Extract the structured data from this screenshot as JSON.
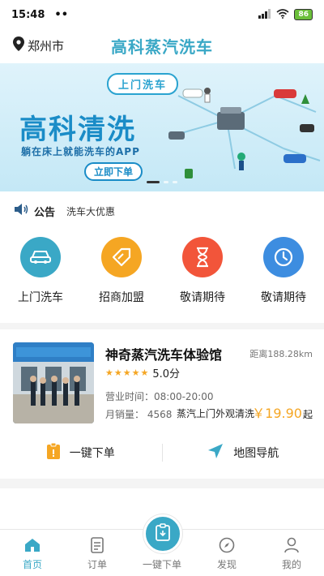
{
  "status_bar": {
    "time": "15:48",
    "dots": "••",
    "battery": "86"
  },
  "header": {
    "location": "郑州市",
    "title": "高科蒸汽洗车"
  },
  "banner": {
    "tag": "上门洗车",
    "heading": "高科清洗",
    "subtitle": "躺在床上就能洗车的APP",
    "button": "立即下单"
  },
  "notice": {
    "title": "公告",
    "text": "洗车大优惠"
  },
  "services": [
    {
      "label": "上门洗车",
      "color": "#3aa8c6",
      "icon": "car-icon"
    },
    {
      "label": "招商加盟",
      "color": "#f5a623",
      "icon": "tag-icon"
    },
    {
      "label": "敬请期待",
      "color": "#f2553a",
      "icon": "hourglass-icon"
    },
    {
      "label": "敬请期待",
      "color": "#3d8de0",
      "icon": "clock-icon"
    }
  ],
  "shop": {
    "name": "神奇蒸汽洗车体验馆",
    "distance": "距离188.28km",
    "rating": "5.0分",
    "stars": 5,
    "hours": "营业时间：08:00-20:00",
    "sales": "月销量：  4568",
    "service_name": "蒸汽上门外观清洗",
    "price": "￥19.90",
    "price_suffix": "起"
  },
  "actions": {
    "order": "一键下单",
    "navigate": "地图导航"
  },
  "tabbar": {
    "home": "首页",
    "orders": "订单",
    "quick_order": "一键下单",
    "discover": "发现",
    "mine": "我的"
  },
  "colors": {
    "accent": "#3aa8c6",
    "price": "#f5a623"
  }
}
